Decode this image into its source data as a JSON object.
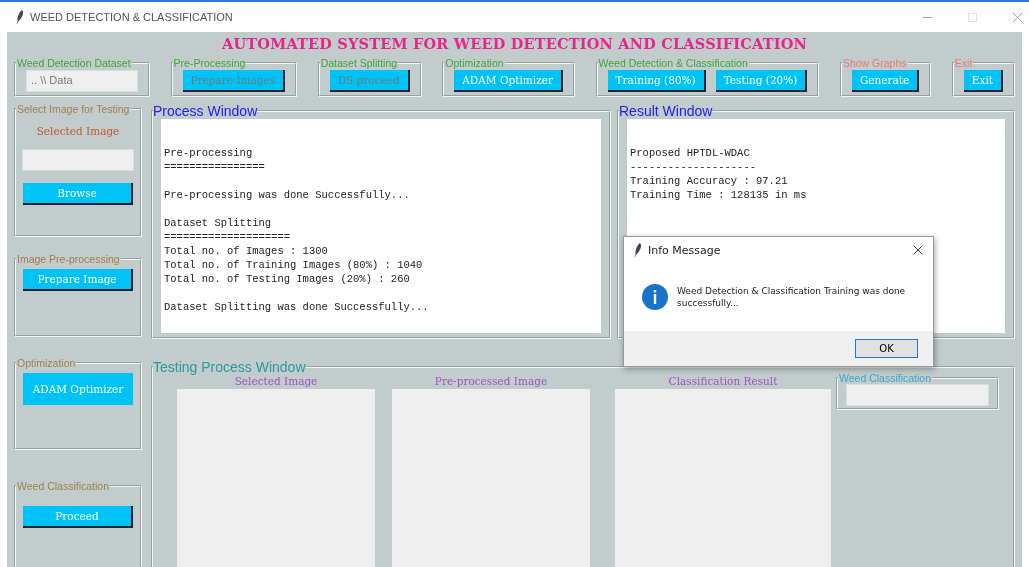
{
  "window": {
    "title": "WEED DETECTION & CLASSIFICATION"
  },
  "heading": "AUTOMATED SYSTEM FOR WEED DETECTION AND CLASSIFICATION",
  "toolbar_groups": [
    {
      "label": "Weed Detection Dataset",
      "color": "#3aa83a",
      "items": [
        {
          "kind": "field",
          "value": ".. \\\\ Data"
        }
      ]
    },
    {
      "label": "Pre-Processing",
      "color": "#3aa83a",
      "items": [
        {
          "kind": "button",
          "label": "Prepare Images",
          "disabled": true
        }
      ]
    },
    {
      "label": "Dataset Splitting",
      "color": "#3aa83a",
      "items": [
        {
          "kind": "button",
          "label": "DS proceed",
          "disabled": true
        }
      ]
    },
    {
      "label": "Optimization",
      "color": "#3aa83a",
      "items": [
        {
          "kind": "button",
          "label": "ADAM Optimizer",
          "disabled": false
        }
      ]
    },
    {
      "label": "Weed Detection & Classification",
      "color": "#3aa83a",
      "items": [
        {
          "kind": "button",
          "label": "Training (80%)",
          "disabled": false
        },
        {
          "kind": "button",
          "label": "Testing (20%)",
          "disabled": false
        }
      ]
    },
    {
      "label": "Show Graphs",
      "color": "#e87a7a",
      "items": [
        {
          "kind": "button",
          "label": "Generate",
          "disabled": false
        }
      ]
    },
    {
      "label": "Exit",
      "color": "#e87a7a",
      "items": [
        {
          "kind": "button",
          "label": "Exit",
          "disabled": false
        }
      ]
    }
  ],
  "side_groups": [
    {
      "label": "Select Image for Testing",
      "items": [
        {
          "kind": "caption",
          "text": "Selected Image"
        },
        {
          "kind": "field"
        },
        {
          "kind": "button",
          "label": "Browse",
          "disabled": false
        }
      ]
    },
    {
      "label": "Image Pre-processing",
      "items": [
        {
          "kind": "button",
          "label": "Prepare Image",
          "disabled": false
        }
      ]
    },
    {
      "label": "Optimization",
      "items": [
        {
          "kind": "button",
          "label": "ADAM Optimizer",
          "disabled": false
        }
      ]
    },
    {
      "label": "Weed Classification",
      "items": [
        {
          "kind": "button",
          "label": "Proceed",
          "disabled": false
        }
      ]
    }
  ],
  "process_window": {
    "title": "Process Window",
    "blocks": [
      [
        "Pre-processing",
        "================"
      ],
      [
        "Pre-processing was done Successfully..."
      ],
      [
        "Dataset Splitting",
        "====================",
        "Total no. of Images : 1300",
        "Total no. of Training Images (80%) : 1040",
        "Total no. of Testing Images (20%) : 260"
      ],
      [
        "Dataset Splitting was done Successfully..."
      ]
    ]
  },
  "result_window": {
    "title": "Result Window",
    "blocks": [
      [
        "Proposed HPTDL-WDAC",
        "--------------------",
        "Training Accuracy : 97.21",
        "Training Time : 128135 in ms"
      ]
    ]
  },
  "testing_window": {
    "title": "Testing Process Window",
    "panels": [
      {
        "label": "Selected Image"
      },
      {
        "label": "Pre-processed Image"
      },
      {
        "label": "Classification Result"
      }
    ],
    "classification": {
      "label": "Weed Classification"
    }
  },
  "dialog": {
    "title": "Info Message",
    "message": "Weed Detection & Classification Training was done successfully...",
    "button": "OK"
  }
}
